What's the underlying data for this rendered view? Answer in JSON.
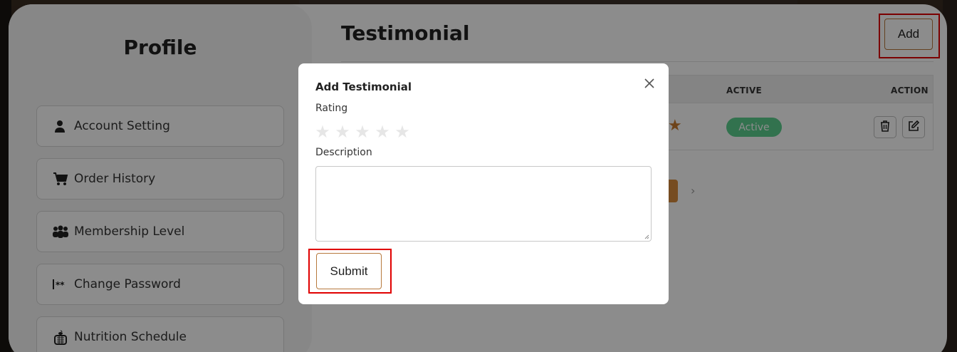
{
  "sidebar": {
    "title": "Profile",
    "items": [
      {
        "label": "Account Setting",
        "icon": "user-plus-icon"
      },
      {
        "label": "Order History",
        "icon": "cart-icon"
      },
      {
        "label": "Membership Level",
        "icon": "users-group-icon"
      },
      {
        "label": "Change Password",
        "icon": "password-icon"
      },
      {
        "label": "Nutrition Schedule",
        "icon": "food-basket-icon"
      }
    ]
  },
  "main": {
    "title": "Testimonial",
    "add_label": "Add",
    "table": {
      "headers": {
        "active": "ACTIVE",
        "action": "ACTION"
      },
      "rows": [
        {
          "status": "Active"
        }
      ]
    }
  },
  "modal": {
    "title": "Add Testimonial",
    "rating_label": "Rating",
    "rating_value": 0,
    "rating_max": 5,
    "description_label": "Description",
    "description_value": "",
    "submit_label": "Submit"
  },
  "colors": {
    "accent": "#b7793d",
    "active_badge": "#5bd08f",
    "highlight": "#e00000"
  }
}
